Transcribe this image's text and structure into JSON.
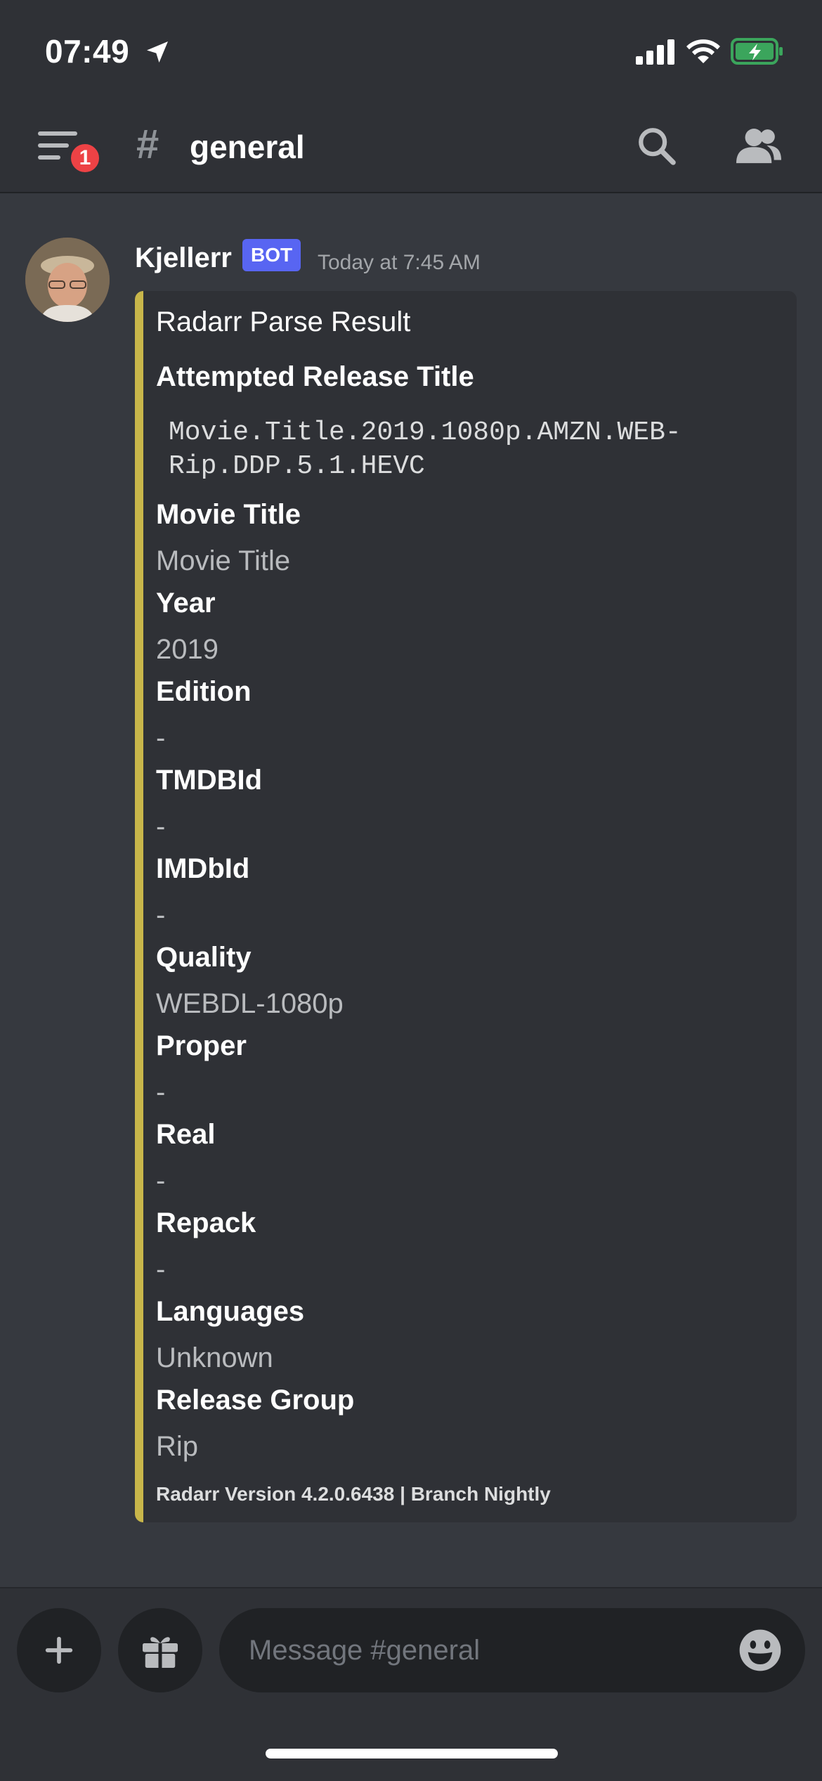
{
  "status_bar": {
    "time": "07:49"
  },
  "header": {
    "notification_count": "1",
    "channel_hash": "#",
    "channel_name": "general"
  },
  "message": {
    "author": "Kjellerr",
    "bot_tag": "BOT",
    "timestamp": "Today at 7:45 AM",
    "embed": {
      "accent_color": "#c8b64a",
      "title": "Radarr Parse Result",
      "fields": [
        {
          "name": "Attempted Release Title",
          "value": ""
        },
        {
          "name": "Movie Title",
          "value": "Movie Title"
        },
        {
          "name": "Year",
          "value": "2019"
        },
        {
          "name": "Edition",
          "value": "-"
        },
        {
          "name": "TMDBId",
          "value": "-"
        },
        {
          "name": "IMDbId",
          "value": "-"
        },
        {
          "name": "Quality",
          "value": "WEBDL-1080p"
        },
        {
          "name": "Proper",
          "value": "-"
        },
        {
          "name": "Real",
          "value": "-"
        },
        {
          "name": "Repack",
          "value": "-"
        },
        {
          "name": "Languages",
          "value": "Unknown"
        },
        {
          "name": "Release Group",
          "value": "Rip"
        }
      ],
      "release_title_line1": "Movie.Title.2019.1080p.AMZN.WEB-",
      "release_title_line2": "Rip.DDP.5.1.HEVC",
      "footer": "Radarr Version 4.2.0.6438 | Branch Nightly"
    }
  },
  "composer": {
    "placeholder": "Message #general"
  },
  "colors": {
    "background": "#36393f",
    "bars": "#2f3136",
    "brand": "#5865f2",
    "badge": "#ed4245",
    "battery": "#3ba55c"
  },
  "icons": [
    "location-arrow-icon",
    "signal-icon",
    "wifi-icon",
    "battery-charging-icon",
    "menu-icon",
    "search-icon",
    "members-icon",
    "plus-icon",
    "gift-icon",
    "emoji-icon"
  ]
}
